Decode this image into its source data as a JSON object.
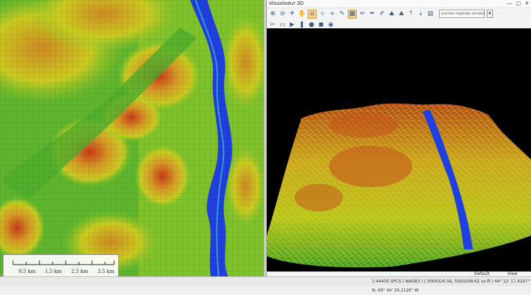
{
  "viewer": {
    "title": "Visualiseur 3D",
    "window_buttons": [
      "—",
      "□",
      "✕"
    ],
    "layer_combo": "Journée tropicale simulatation"
  },
  "toolbar_row1": [
    {
      "icon": "zoom-in-icon",
      "glyph": "⊕"
    },
    {
      "icon": "zoom-out-icon",
      "glyph": "⊖"
    },
    {
      "icon": "fly-icon",
      "glyph": "✈"
    },
    {
      "icon": "hand-icon",
      "glyph": "✋"
    },
    {
      "icon": "home-icon",
      "glyph": "⌂"
    },
    {
      "icon": "target-icon",
      "glyph": "⊹"
    },
    {
      "icon": "crosshair-icon",
      "glyph": "+"
    },
    {
      "icon": "wrench-icon",
      "glyph": "✎"
    },
    {
      "icon": "surface-icon",
      "glyph": "▦"
    },
    {
      "icon": "pencil-icon",
      "glyph": "✏"
    },
    {
      "icon": "pen-icon",
      "glyph": "✒"
    },
    {
      "icon": "brush-icon",
      "glyph": "✐"
    },
    {
      "icon": "elevation-up-icon",
      "glyph": "⛰"
    },
    {
      "icon": "elevation-down-icon",
      "glyph": "⛰"
    },
    {
      "icon": "exaggerate-up-icon",
      "glyph": "⇡"
    },
    {
      "icon": "exaggerate-down-icon",
      "glyph": "⇣"
    },
    {
      "icon": "render-icon",
      "glyph": "▤"
    }
  ],
  "toolbar_row2": [
    {
      "icon": "tools-icon",
      "glyph": "✂"
    },
    {
      "icon": "camera-mode-icon",
      "glyph": "▭"
    },
    {
      "icon": "play-icon",
      "glyph": "▶"
    },
    {
      "icon": "pause-icon",
      "glyph": "❚"
    },
    {
      "icon": "record-icon",
      "glyph": "●"
    },
    {
      "icon": "video-icon",
      "glyph": "◼"
    },
    {
      "icon": "snapshot-icon",
      "glyph": "◉"
    }
  ],
  "scene_footer": {
    "default_label": "Default",
    "view_label": "View"
  },
  "scalebar": {
    "labels": [
      "0.5 km",
      "1.5 km",
      "2.5 km",
      "3.5 km"
    ]
  },
  "statusbar": {
    "text": "1:44456   SPCS ( NAD83 ) | 3064326.56, 5050208.62 us-ft  |  44° 12' 17.4297\" N, 69° 44' 29.2126\" W"
  },
  "colors": {
    "water": "#1f3fe0",
    "low": "#2aa02a",
    "mid": "#d8d020",
    "high": "#d02010"
  }
}
